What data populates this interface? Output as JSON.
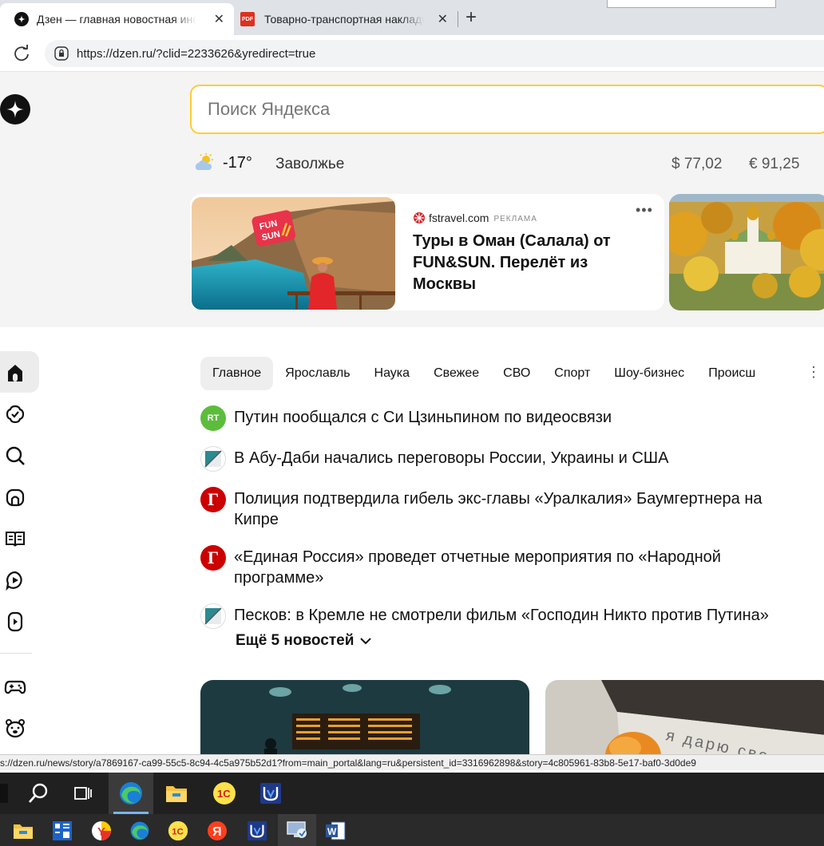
{
  "browser": {
    "tabs": [
      {
        "title": "Дзен — главная новостная информация",
        "close": "✕"
      },
      {
        "title": "Товарно-транспортная накладная",
        "close": "✕"
      }
    ],
    "new_tab": "+",
    "reload": "C",
    "url": "https://dzen.ru/?clid=2233626&yredirect=true"
  },
  "header": {
    "search_placeholder": "Поиск Яндекса",
    "weather": {
      "temp": "-17°",
      "icon": "partly-cloudy-icon"
    },
    "city": "Заволжье",
    "usd": "$ 77,02",
    "eur": "€ 91,25"
  },
  "ad": {
    "domain": "fstravel.com",
    "label": "РЕКЛАМА",
    "title": "Туры в Оман (Салала) от FUN&SUN. Перелёт из Москвы",
    "dots": "•••",
    "badge": "FUN SUN"
  },
  "sidebar": {
    "items": [
      {
        "icon": "home-icon"
      },
      {
        "icon": "subscriptions-icon"
      },
      {
        "icon": "search-icon"
      },
      {
        "icon": "stories-icon"
      },
      {
        "icon": "articles-icon"
      },
      {
        "icon": "video-icon"
      },
      {
        "icon": "shorts-icon"
      },
      {
        "icon": "games-icon"
      },
      {
        "icon": "kids-icon"
      }
    ]
  },
  "nav_tabs": [
    "Главное",
    "Ярославль",
    "Наука",
    "Свежее",
    "СВО",
    "Спорт",
    "Шоу-бизнес",
    "Происш"
  ],
  "nav_more": "⋮",
  "news": [
    {
      "source": "rt",
      "source_label": "RT",
      "text": "Путин пообщался с Си Цзиньпином по видеосвязи"
    },
    {
      "source": "tass",
      "source_label": "",
      "text": "В Абу-Даби начались переговоры России, Украины и США"
    },
    {
      "source": "g",
      "source_label": "Г",
      "text": "Полиция подтвердила гибель экс-главы «Уралкалия» Баумгертнера на Кипре"
    },
    {
      "source": "g",
      "source_label": "Г",
      "text": "«Единая Россия» проведет отчетные мероприятия по «Народной программе»"
    },
    {
      "source": "tass",
      "source_label": "",
      "text": "Песков: в Кремле не смотрели фильм «Господин Никто против Путина»"
    }
  ],
  "more_news": "Ещё 5 новостей",
  "bottom_card_text": "я дарю сво",
  "status_url": "s://dzen.ru/news/story/a7869167-ca99-55c5-8c94-4c5a975b52d1?from=main_portal&lang=ru&persistent_id=3316962898&story=4c805961-83b8-5e17-baf0-3d0de9",
  "taskbar": {
    "row1": [
      "search-icon",
      "task-view-icon",
      "edge-icon",
      "file-explorer-icon",
      "1c-icon",
      "uw-app-icon"
    ],
    "row2": [
      "file-explorer-icon",
      "calculator-icon",
      "yandex-browser-icon",
      "edge-icon",
      "1c-icon",
      "yandex-icon",
      "uw-app-icon",
      "remote-desktop-icon",
      "word-icon"
    ]
  },
  "colors": {
    "search_border": "#ffcc33",
    "accent": "#111111"
  }
}
